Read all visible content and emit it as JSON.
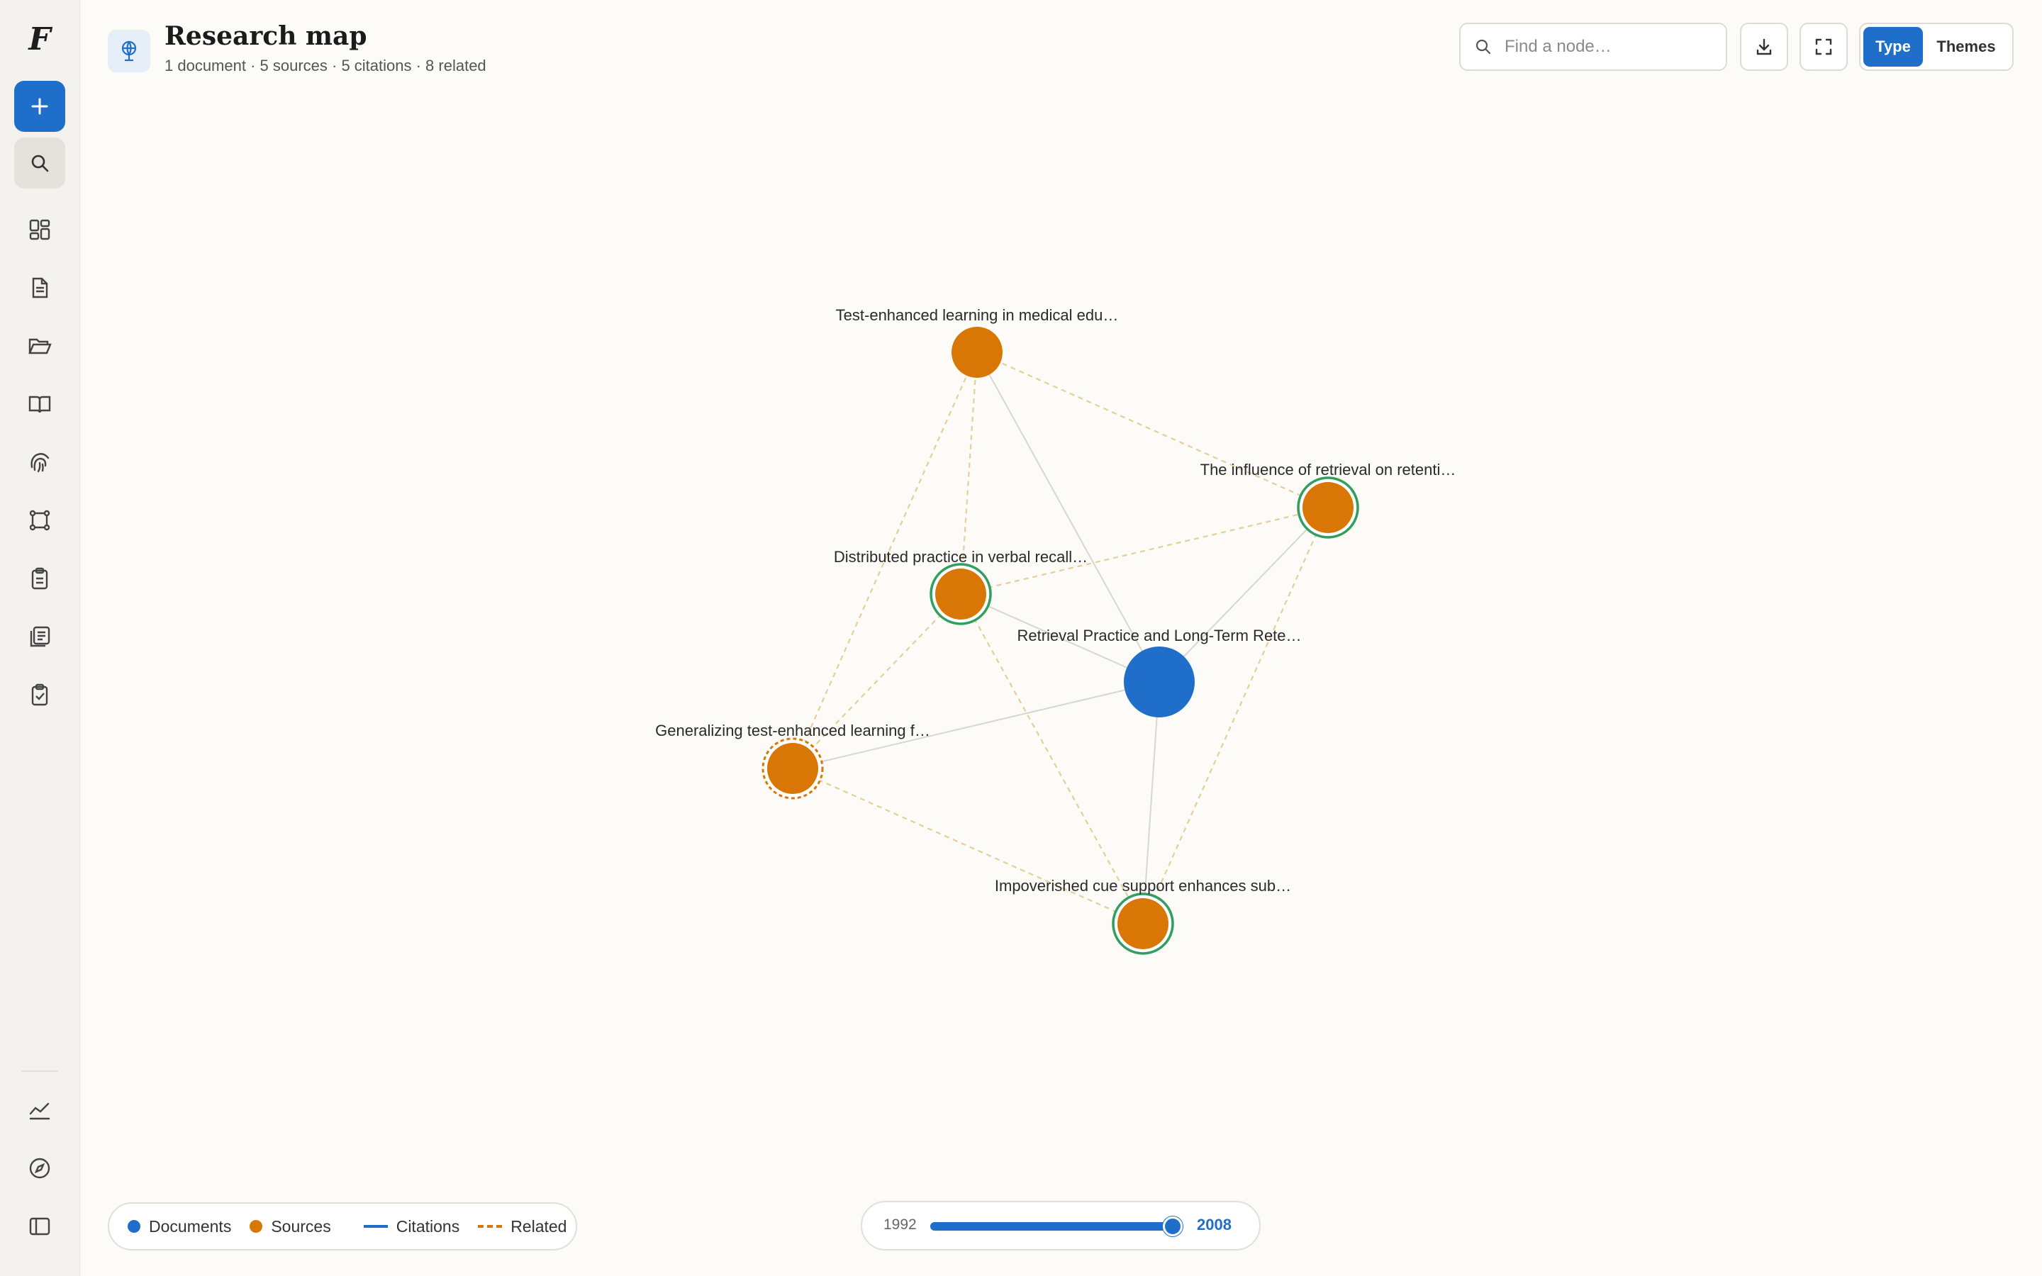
{
  "app": {
    "logo": "F"
  },
  "header": {
    "title": "Research map",
    "subtitle": "1 document · 5 sources · 5 citations · 8 related"
  },
  "search": {
    "placeholder": "Find a node…",
    "value": ""
  },
  "view_toggle": {
    "options": [
      "Type",
      "Themes"
    ],
    "selected": "Type"
  },
  "nodes": [
    {
      "id": "doc",
      "label": "Retrieval Practice and Long-Term Rete…",
      "kind": "document",
      "ring": "none"
    },
    {
      "id": "s1",
      "label": "Test-enhanced learning in medical edu…",
      "kind": "source",
      "ring": "none"
    },
    {
      "id": "s2",
      "label": "The influence of retrieval on retenti…",
      "kind": "source",
      "ring": "solid"
    },
    {
      "id": "s3",
      "label": "Distributed practice in verbal recall…",
      "kind": "source",
      "ring": "solid"
    },
    {
      "id": "s4",
      "label": "Generalizing test-enhanced learning f…",
      "kind": "source",
      "ring": "dashed"
    },
    {
      "id": "s5",
      "label": "Impoverished cue support enhances sub…",
      "kind": "source",
      "ring": "solid"
    }
  ],
  "edges": [
    {
      "from": "doc",
      "to": "s1",
      "type": "citation"
    },
    {
      "from": "doc",
      "to": "s2",
      "type": "citation"
    },
    {
      "from": "doc",
      "to": "s3",
      "type": "citation"
    },
    {
      "from": "doc",
      "to": "s4",
      "type": "citation"
    },
    {
      "from": "doc",
      "to": "s5",
      "type": "citation"
    },
    {
      "from": "s1",
      "to": "s2",
      "type": "related"
    },
    {
      "from": "s1",
      "to": "s3",
      "type": "related"
    },
    {
      "from": "s1",
      "to": "s4",
      "type": "related"
    },
    {
      "from": "s3",
      "to": "s2",
      "type": "related"
    },
    {
      "from": "s3",
      "to": "s4",
      "type": "related"
    },
    {
      "from": "s3",
      "to": "s5",
      "type": "related"
    },
    {
      "from": "s4",
      "to": "s5",
      "type": "related"
    },
    {
      "from": "s2",
      "to": "s5",
      "type": "related"
    }
  ],
  "legend": {
    "documents": "Documents",
    "sources": "Sources",
    "citations": "Citations",
    "related": "Related"
  },
  "timeline": {
    "start": "1992",
    "end": "2008",
    "position": 1.0
  },
  "colors": {
    "document": "#1f6fca",
    "source": "#d97706",
    "ring": "#2f9e5f",
    "citation_edge": "#d9d6d0",
    "related_edge": "#e3cf97",
    "accent": "#1f6fca"
  },
  "sidebar_icons": [
    "new-item-icon",
    "search-icon",
    "dashboard-icon",
    "document-icon",
    "folder-icon",
    "book-icon",
    "fingerprint-icon",
    "map-icon",
    "clipboard-icon",
    "library-icon",
    "checklist-icon",
    "analytics-icon",
    "explore-icon",
    "sidebar-toggle-icon"
  ]
}
